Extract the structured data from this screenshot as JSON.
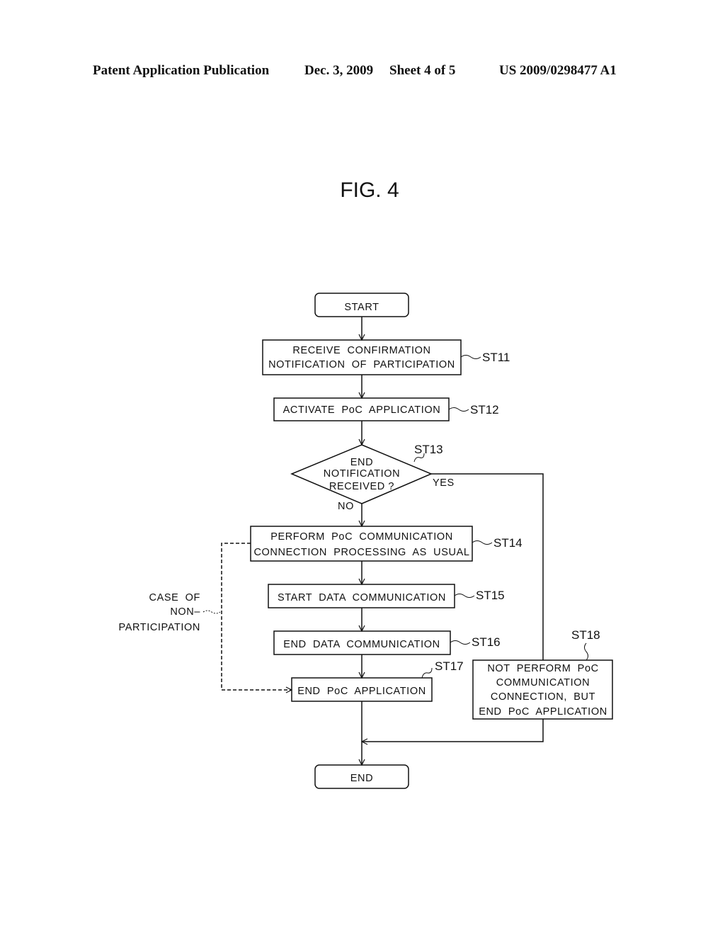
{
  "header": {
    "publication": "Patent Application Publication",
    "date": "Dec. 3, 2009",
    "sheet": "Sheet 4 of 5",
    "number": "US 2009/0298477 A1"
  },
  "figure": {
    "title": "FIG. 4",
    "start": "START",
    "end": "END",
    "steps": {
      "st11": {
        "id": "ST11",
        "lines": [
          "RECEIVE  CONFIRMATION",
          "NOTIFICATION  OF  PARTICIPATION"
        ]
      },
      "st12": {
        "id": "ST12",
        "lines": [
          "ACTIVATE  PoC  APPLICATION"
        ]
      },
      "st13": {
        "id": "ST13",
        "lines": [
          "END",
          "NOTIFICATION",
          "RECEIVED ?"
        ],
        "yes": "YES",
        "no": "NO"
      },
      "st14": {
        "id": "ST14",
        "lines": [
          "PERFORM  PoC  COMMUNICATION",
          "CONNECTION  PROCESSING  AS  USUAL"
        ]
      },
      "st15": {
        "id": "ST15",
        "lines": [
          "START  DATA  COMMUNICATION"
        ]
      },
      "st16": {
        "id": "ST16",
        "lines": [
          "END  DATA  COMMUNICATION"
        ]
      },
      "st17": {
        "id": "ST17",
        "lines": [
          "END  PoC  APPLICATION"
        ]
      },
      "st18": {
        "id": "ST18",
        "lines": [
          "NOT  PERFORM  PoC",
          "COMMUNICATION",
          "CONNECTION,  BUT",
          "END  PoC  APPLICATION"
        ]
      }
    },
    "non_participation_label": [
      "CASE  OF",
      "NON–",
      "PARTICIPATION"
    ]
  }
}
